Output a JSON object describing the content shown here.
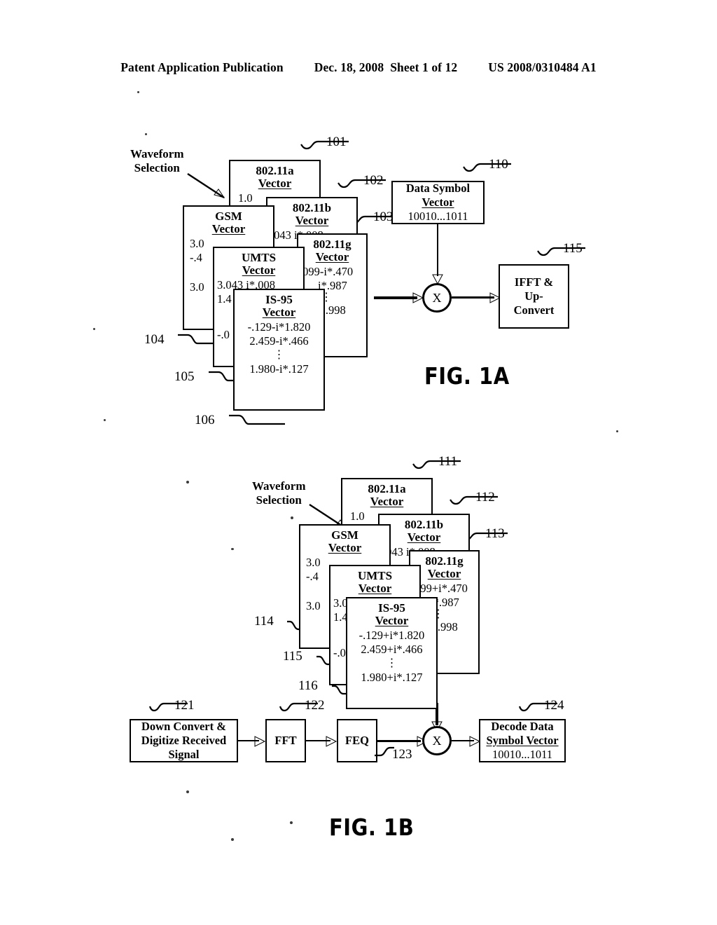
{
  "header": {
    "publication": "Patent Application Publication",
    "date": "Dec. 18, 2008",
    "sheet": "Sheet 1 of 12",
    "number": "US 2008/0310484 A1"
  },
  "figures": [
    {
      "caption": "FIG. 1A",
      "waveform_selection_label": "Waveform\nSelection",
      "waveform_selection_line1": "Waveform",
      "waveform_selection_line2": "Selection",
      "vector_stack": [
        {
          "ref": "101",
          "title": "802.11a",
          "subtitle": "Vector",
          "rows": [
            "1.0"
          ]
        },
        {
          "ref": "102",
          "title": "802.11b",
          "subtitle": "Vector",
          "rows": [
            ".043 i* 008"
          ]
        },
        {
          "ref": "103",
          "title": "802.11g",
          "subtitle": "Vector",
          "rows": [
            ".099-i*.470",
            "i*.987",
            "i*.998"
          ]
        },
        {
          "ref": "104",
          "title": "GSM",
          "subtitle": "Vector",
          "rows": [
            "3.0",
            "-.4",
            "3.0"
          ]
        },
        {
          "ref": "105",
          "title": "UMTS",
          "subtitle": "Vector",
          "rows": [
            "3.043 i*.008",
            "1.4",
            "-.0"
          ]
        },
        {
          "ref": "106",
          "title": "IS-95",
          "subtitle": "Vector",
          "rows": [
            "-.129-i*1.820",
            "2.459-i*.466",
            "1.980-i*.127"
          ]
        }
      ],
      "data_symbol_block": {
        "ref": "110",
        "line1": "Data Symbol",
        "line2": "Vector",
        "line3": "10010...1011"
      },
      "multiplier": {
        "label": "X"
      },
      "output_block": {
        "ref": "115",
        "line1": "IFFT &",
        "line2": "Up-",
        "line3": "Convert"
      }
    },
    {
      "caption": "FIG. 1B",
      "waveform_selection_line1": "Waveform",
      "waveform_selection_line2": "Selection",
      "vector_stack": [
        {
          "ref": "111",
          "title": "802.11a",
          "subtitle": "Vector",
          "rows": [
            "1.0"
          ]
        },
        {
          "ref": "112",
          "title": "802.11b",
          "subtitle": "Vector",
          "rows": [
            ".043 i* 008"
          ]
        },
        {
          "ref": "113",
          "title": "802.11g",
          "subtitle": "Vector",
          "rows": [
            ".099+i*.470",
            "i*.987",
            "i*.998"
          ]
        },
        {
          "ref": "114",
          "title": "GSM",
          "subtitle": "Vector",
          "rows": [
            "3.0",
            "-.4",
            "3.0"
          ]
        },
        {
          "ref": "115",
          "title": "UMTS",
          "subtitle": "Vector",
          "rows": [
            "3.043 i*.008",
            "1.4",
            "-.0"
          ]
        },
        {
          "ref": "116",
          "title": "IS-95",
          "subtitle": "Vector",
          "rows": [
            "-.129+i*1.820",
            "2.459+i*.466",
            "1.980+i*.127"
          ]
        }
      ],
      "receiver_chain": [
        {
          "ref": "121",
          "line1": "Down Convert &",
          "line2": "Digitize Received",
          "line3": "Signal"
        },
        {
          "ref": "122",
          "line1": "FFT"
        },
        {
          "ref": "123",
          "line1": "FEQ"
        }
      ],
      "multiplier": {
        "label": "X"
      },
      "decode_block": {
        "ref": "124",
        "line1": "Decode Data",
        "line2": "Symbol Vector",
        "line3": "10010...1011"
      }
    }
  ]
}
